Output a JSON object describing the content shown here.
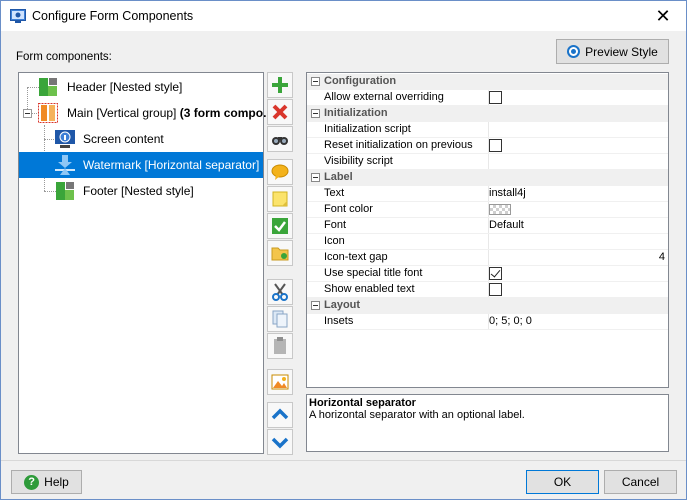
{
  "window": {
    "title": "Configure Form Components",
    "close_glyph": "✕"
  },
  "left": {
    "label": "Form components:"
  },
  "preview_button": {
    "label": "Preview Style"
  },
  "tree": {
    "items": [
      {
        "text": "Header [Nested style]"
      },
      {
        "text": "Main [Vertical group]",
        "bold_suffix": "(3 form compo..."
      },
      {
        "text": "Screen content"
      },
      {
        "text": "Watermark [Horizontal separator]"
      },
      {
        "text": "Footer [Nested style]"
      }
    ]
  },
  "toolbar": {
    "buttons": [
      "add-icon",
      "delete-icon",
      "find-icon",
      "comment-icon",
      "note-icon",
      "check-icon",
      "folder-icon",
      "cut-icon",
      "copy-icon",
      "paste-icon",
      "image-icon",
      "move-up-icon",
      "move-down-icon"
    ]
  },
  "properties": {
    "categories": {
      "configuration": "Configuration",
      "initialization": "Initialization",
      "label": "Label",
      "layout": "Layout"
    },
    "rows": {
      "allow_external_overriding": "Allow external overriding",
      "initialization_script": "Initialization script",
      "reset_initialization": "Reset initialization on previous",
      "visibility_script": "Visibility script",
      "text": "Text",
      "text_value": "install4j",
      "font_color": "Font color",
      "font": "Font",
      "font_value": "Default",
      "icon": "Icon",
      "icon_text_gap": "Icon-text gap",
      "icon_text_gap_value": "4",
      "use_special_title_font": "Use special title font",
      "show_enabled_text": "Show enabled text",
      "insets": "Insets",
      "insets_value": "0; 5; 0; 0"
    }
  },
  "description": {
    "title": "Horizontal separator",
    "text": "A horizontal separator with an optional label."
  },
  "buttons": {
    "help": "Help",
    "ok": "OK",
    "cancel": "Cancel"
  },
  "colors": {
    "selection": "#0078d7",
    "accent_green": "#3aa53a",
    "accent_red": "#d9352b"
  }
}
